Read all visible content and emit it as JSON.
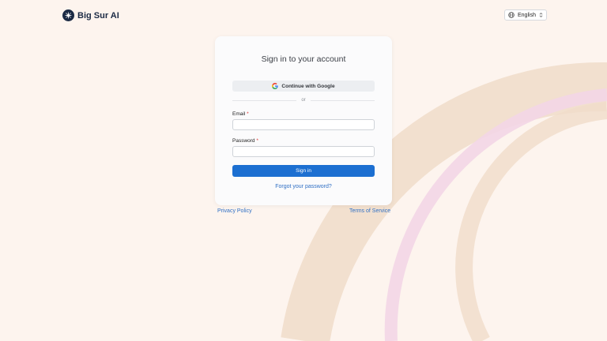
{
  "brand": {
    "name": "Big Sur AI",
    "icon": "compass-star-icon"
  },
  "language": {
    "selected": "English",
    "icon": "globe-icon",
    "chevron_icon": "chevron-updown-icon"
  },
  "signin": {
    "title": "Sign in to your account",
    "google_label": "Continue with Google",
    "divider_text": "or",
    "email_label": "Email",
    "email_value": "",
    "password_label": "Password",
    "password_value": "",
    "required_mark": "*",
    "submit_label": "Sign in",
    "forgot_label": "Forgot your password?"
  },
  "footer": {
    "privacy_label": "Privacy Policy",
    "terms_label": "Terms of Service"
  },
  "colors": {
    "background": "#fdf4ee",
    "primary": "#1c6fd1",
    "link": "#2f6fc4",
    "brand_dark": "#1b2a44",
    "required": "#e03131"
  }
}
